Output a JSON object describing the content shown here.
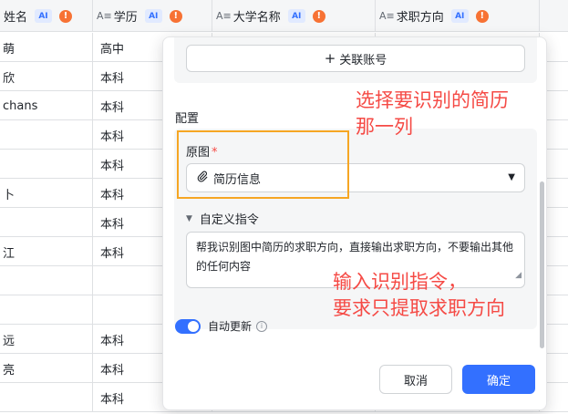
{
  "table": {
    "columns": [
      {
        "icon": "",
        "label": "姓名"
      },
      {
        "icon": "A≡",
        "label": "学历"
      },
      {
        "icon": "A≡",
        "label": "大学名称"
      },
      {
        "icon": "A≡",
        "label": "求职方向"
      }
    ],
    "ai_badge": "AI",
    "warn_badge": "!",
    "rows": [
      {
        "name": "萌",
        "edu": "高中"
      },
      {
        "name": "欣",
        "edu": "本科"
      },
      {
        "name": "chans",
        "edu": "本科"
      },
      {
        "name": "",
        "edu": "本科"
      },
      {
        "name": "",
        "edu": "本科"
      },
      {
        "name": "卜",
        "edu": "本科"
      },
      {
        "name": "",
        "edu": "本科"
      },
      {
        "name": "江",
        "edu": "本科"
      },
      {
        "name": "",
        "edu": ""
      },
      {
        "name": "",
        "edu": ""
      },
      {
        "name": "远",
        "edu": "本科"
      },
      {
        "name": "亮",
        "edu": "本科"
      },
      {
        "name": "",
        "edu": "本科"
      }
    ]
  },
  "dialog": {
    "link_account_label": "关联账号",
    "section_title": "配置",
    "source_field_label": "原图",
    "required_mark": "*",
    "source_field_value": "简历信息",
    "custom_instruction_label": "自定义指令",
    "instruction_text": "帮我识别图中简历的求职方向，直接输出求职方向，不要输出其他的任何内容",
    "auto_update_label": "自动更新",
    "auto_update_on": true,
    "cancel_label": "取消",
    "confirm_label": "确定"
  },
  "annotations": {
    "note1_line1": "选择要识别的简历",
    "note1_line2": "那一列",
    "note2_line1": "输入识别指令，",
    "note2_line2": "要求只提取求职方向"
  },
  "colors": {
    "primary": "#3370ff",
    "annotation": "#f54a45",
    "highlight": "#f6a623",
    "warn": "#f77234"
  }
}
